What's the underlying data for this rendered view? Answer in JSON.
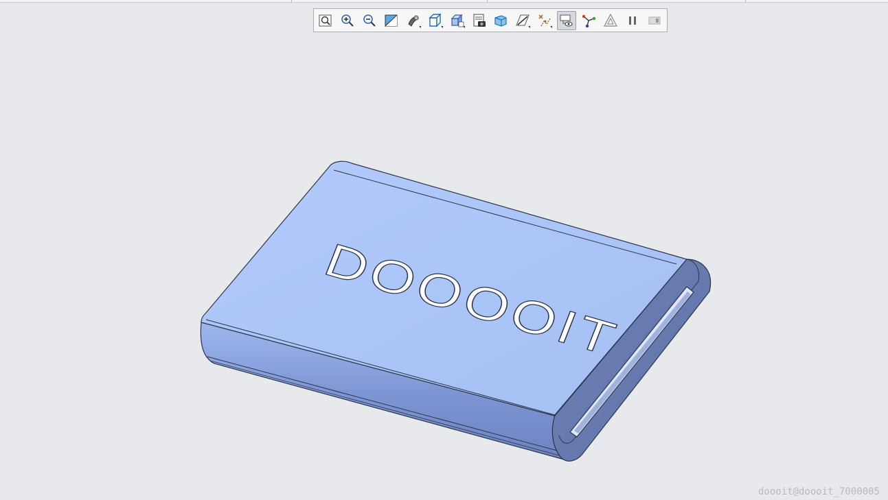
{
  "toolbar": {
    "buttons": [
      {
        "name": "refit-icon",
        "tooltip": ""
      },
      {
        "name": "zoom-in-icon"
      },
      {
        "name": "zoom-out-icon"
      },
      {
        "name": "repaint-icon"
      },
      {
        "name": "reorient-icon"
      },
      {
        "name": "saved-orientations-icon"
      },
      {
        "name": "display-style-icon"
      },
      {
        "name": "view-manager-icon"
      },
      {
        "name": "perspective-view-icon"
      },
      {
        "name": "section-icon"
      },
      {
        "name": "datum-display-icon"
      },
      {
        "name": "annotation-display-icon",
        "active": true
      },
      {
        "name": "spin-center-icon"
      },
      {
        "name": "appearance-icon"
      },
      {
        "name": "pause-icon"
      },
      {
        "name": "next-step-icon"
      }
    ]
  },
  "model": {
    "engraved_text": "DOOOOIT",
    "body_color": "#a9c3f7",
    "side_color": "#6f83b8",
    "edge_color": "#2b3548"
  },
  "watermark": "doooit@doooit_7000005"
}
